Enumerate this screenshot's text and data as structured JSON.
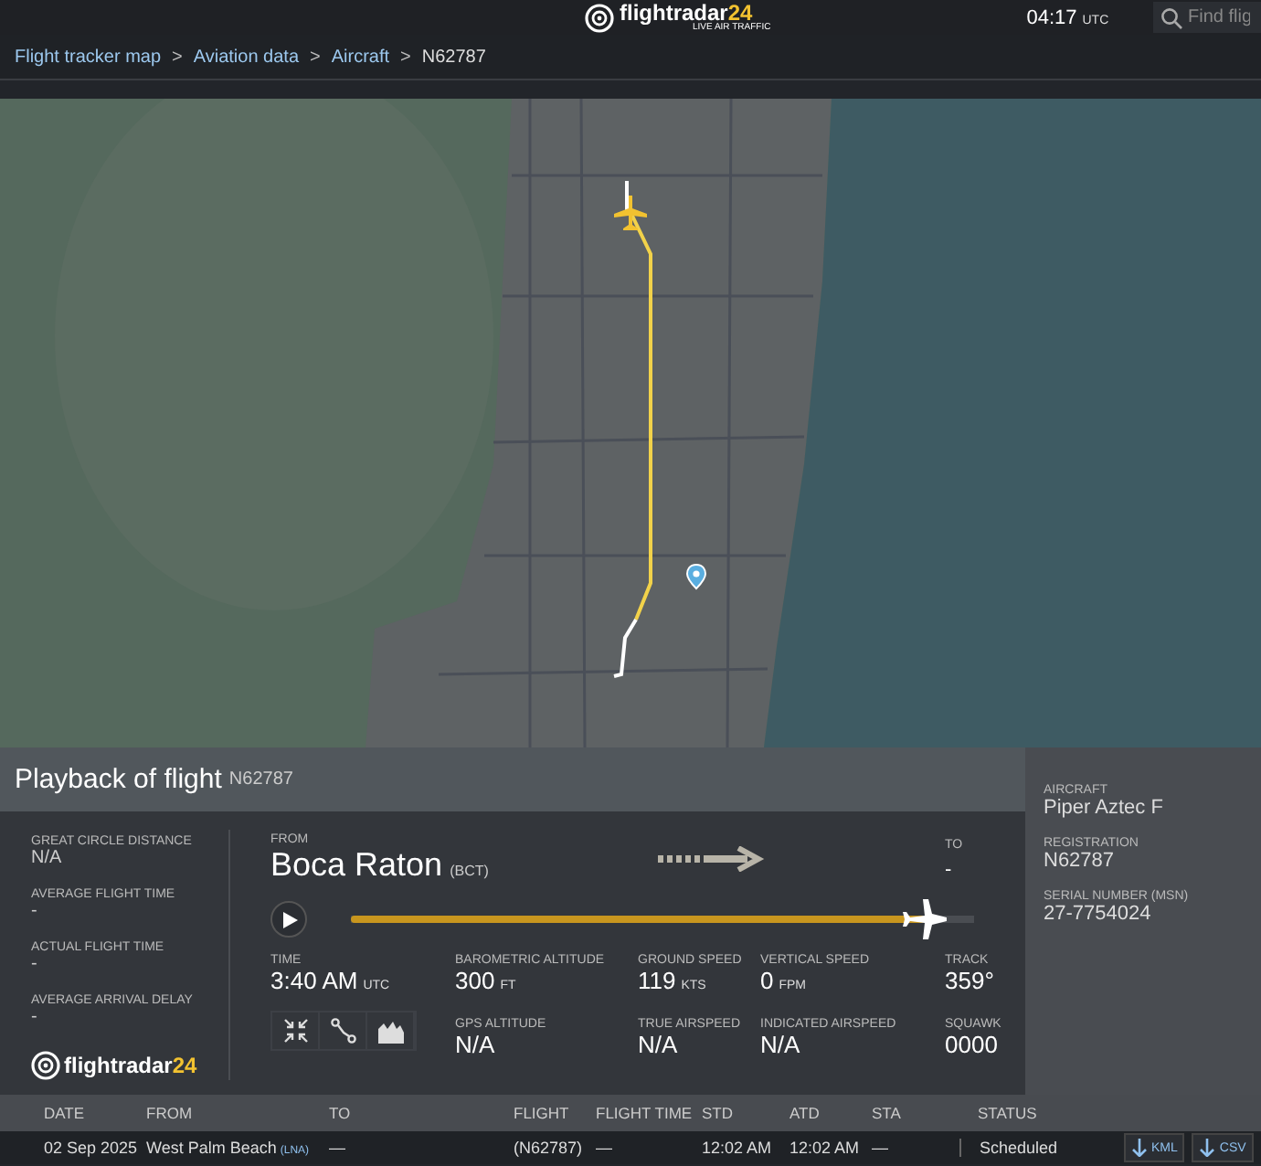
{
  "header": {
    "logo": {
      "name": "flightradar",
      "accent": "24",
      "tagline": "LIVE AIR TRAFFIC"
    },
    "clock": {
      "time": "04:17",
      "zone": "UTC"
    },
    "search": {
      "placeholder": "Find flig"
    }
  },
  "breadcrumb_separator": ">",
  "breadcrumbs": [
    {
      "label": "Flight tracker map",
      "kind": "link"
    },
    {
      "label": "Aviation data",
      "kind": "link"
    },
    {
      "label": "Aircraft",
      "kind": "link"
    },
    {
      "label": "N62787",
      "kind": "current"
    }
  ],
  "playback": {
    "title": "Playback of flight",
    "registration": "N62787"
  },
  "stats": [
    {
      "label": "GREAT CIRCLE DISTANCE",
      "value": "N/A"
    },
    {
      "label": "AVERAGE FLIGHT TIME",
      "value": "-"
    },
    {
      "label": "ACTUAL FLIGHT TIME",
      "value": "-"
    },
    {
      "label": "AVERAGE ARRIVAL DELAY",
      "value": "-"
    }
  ],
  "footer_logo": {
    "name": "flightradar",
    "accent": "24"
  },
  "route": {
    "from_label": "FROM",
    "from_city": "Boca Raton",
    "from_code": "(BCT)",
    "to_label": "TO",
    "to_value": "-"
  },
  "timeline": {
    "level": 0.92
  },
  "readings": [
    [
      {
        "label": "TIME",
        "value": "3:40 AM",
        "unit": "UTC"
      }
    ],
    [
      {
        "label": "BAROMETRIC ALTITUDE",
        "value": "300",
        "unit": "FT"
      },
      {
        "label": "GPS ALTITUDE",
        "value": "N/A"
      }
    ],
    [
      {
        "label": "GROUND SPEED",
        "value": "119",
        "unit": "KTS"
      },
      {
        "label": "TRUE AIRSPEED",
        "value": "N/A"
      }
    ],
    [
      {
        "label": "VERTICAL SPEED",
        "value": "0",
        "unit": "FPM"
      },
      {
        "label": "INDICATED AIRSPEED",
        "value": "N/A"
      }
    ],
    [
      {
        "label": "TRACK",
        "value": "359°"
      },
      {
        "label": "SQUAWK",
        "value": "0000"
      }
    ]
  ],
  "aircraft": [
    {
      "label": "AIRCRAFT",
      "value": "Piper Aztec F"
    },
    {
      "label": "REGISTRATION",
      "value": "N62787"
    },
    {
      "label": "SERIAL NUMBER (MSN)",
      "value": "27-7754024"
    }
  ],
  "table": {
    "columns": [
      "DATE",
      "FROM",
      "TO",
      "FLIGHT",
      "FLIGHT TIME",
      "STD",
      "ATD",
      "STA",
      "STATUS"
    ],
    "rows": [
      {
        "cells": [
          "02 Sep 2025",
          "West Palm Beach",
          "—",
          "(N62787)",
          "—",
          "12:02 AM",
          "12:02 AM",
          "—",
          "Scheduled"
        ],
        "from_code": "(LNA)",
        "downloads": [
          "KML",
          "CSV"
        ]
      }
    ]
  }
}
